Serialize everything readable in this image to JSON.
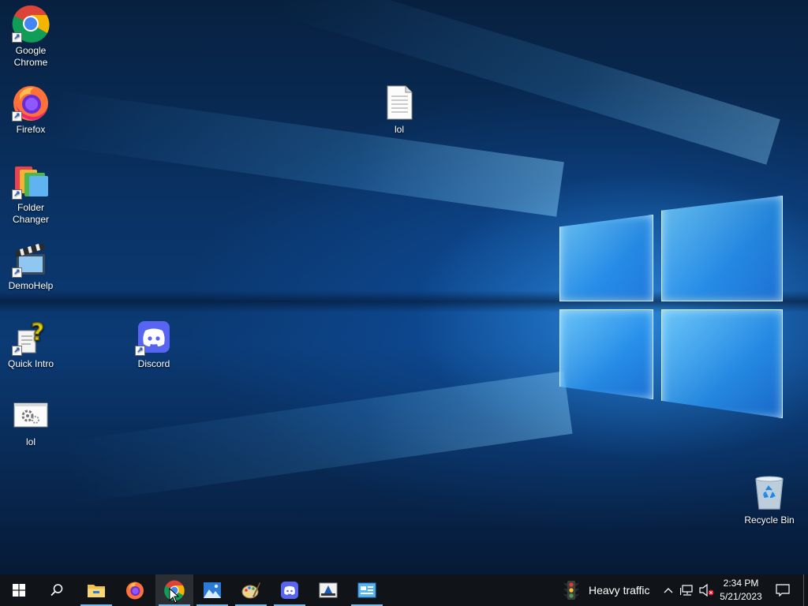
{
  "desktop_icons": [
    {
      "label": "Google Chrome",
      "icon": "chrome-icon",
      "shortcut": true
    },
    {
      "label": "Firefox",
      "icon": "firefox-icon",
      "shortcut": true
    },
    {
      "label": "Folder Changer",
      "icon": "folder-changer-icon",
      "shortcut": true
    },
    {
      "label": "DemoHelp",
      "icon": "demohelp-icon",
      "shortcut": true
    },
    {
      "label": "Quick Intro",
      "icon": "quick-intro-icon",
      "shortcut": true
    },
    {
      "label": "lol",
      "icon": "settings-window-icon",
      "shortcut": false
    },
    {
      "label": "Discord",
      "icon": "discord-icon",
      "shortcut": true
    },
    {
      "label": "lol",
      "icon": "text-file-icon",
      "shortcut": false
    },
    {
      "label": "Recycle Bin",
      "icon": "recycle-bin-icon",
      "shortcut": false
    }
  ],
  "taskbar": {
    "buttons": [
      {
        "name": "start",
        "icon": "windows-logo-icon"
      },
      {
        "name": "search",
        "icon": "search-icon"
      },
      {
        "name": "file-explorer",
        "icon": "folder-icon",
        "active": true
      },
      {
        "name": "firefox",
        "icon": "firefox-icon"
      },
      {
        "name": "chrome",
        "icon": "chrome-icon",
        "active": true,
        "hovered": true
      },
      {
        "name": "photos",
        "icon": "photos-icon",
        "active": true
      },
      {
        "name": "paint",
        "icon": "paint-palette-icon",
        "active": true
      },
      {
        "name": "discord",
        "icon": "discord-icon",
        "active": true
      },
      {
        "name": "app",
        "icon": "app-window-icon"
      },
      {
        "name": "control-panel",
        "icon": "control-panel-icon",
        "active": true
      }
    ],
    "weather_text": "Heavy traffic",
    "time": "2:34 PM",
    "date": "5/21/2023"
  },
  "colors": {
    "taskbar_bg": "#101418",
    "active_indicator": "#76b9ed",
    "desktop_blue": "#0b3a74"
  }
}
